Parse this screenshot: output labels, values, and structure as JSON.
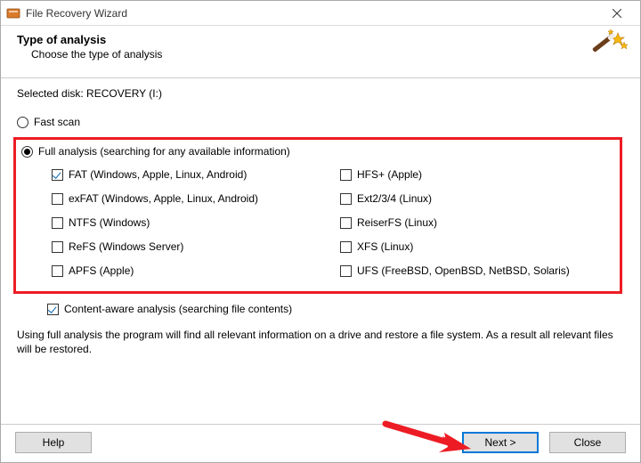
{
  "window": {
    "title": "File Recovery Wizard"
  },
  "header": {
    "heading": "Type of analysis",
    "subtitle": "Choose the type of analysis"
  },
  "selected_disk_label": "Selected disk: RECOVERY (I:)",
  "analysis": {
    "fast_label": "Fast scan",
    "full_label": "Full analysis (searching for any available information)",
    "content_aware_label": "Content-aware analysis (searching file contents)"
  },
  "filesystems": {
    "left": [
      "FAT (Windows, Apple, Linux, Android)",
      "exFAT (Windows, Apple, Linux, Android)",
      "NTFS (Windows)",
      "ReFS (Windows Server)",
      "APFS (Apple)"
    ],
    "right": [
      "HFS+ (Apple)",
      "Ext2/3/4 (Linux)",
      "ReiserFS (Linux)",
      "XFS (Linux)",
      "UFS (FreeBSD, OpenBSD, NetBSD, Solaris)"
    ]
  },
  "description": "Using full analysis the program will find all relevant information on a drive and restore a file system. As a result all relevant files will be restored.",
  "buttons": {
    "help": "Help",
    "next": "Next >",
    "close": "Close"
  }
}
